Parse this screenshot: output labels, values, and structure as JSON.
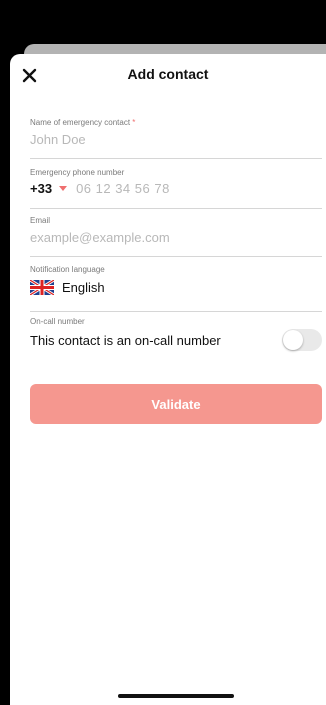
{
  "header": {
    "title": "Add contact"
  },
  "form": {
    "name": {
      "label": "Name of emergency contact",
      "required_mark": "*",
      "placeholder": "John Doe"
    },
    "phone": {
      "label": "Emergency phone number",
      "country_code": "+33",
      "placeholder": "06 12 34 56 78"
    },
    "email": {
      "label": "Email",
      "placeholder": "example@example.com"
    },
    "language": {
      "label": "Notification language",
      "value": "English",
      "flag_icon": "uk-flag-icon"
    },
    "oncall": {
      "label": "On-call number",
      "text": "This contact is an on-call number",
      "enabled": false
    }
  },
  "actions": {
    "validate_label": "Validate"
  },
  "colors": {
    "accent": "#f5978f",
    "required": "#ef6f6f"
  }
}
